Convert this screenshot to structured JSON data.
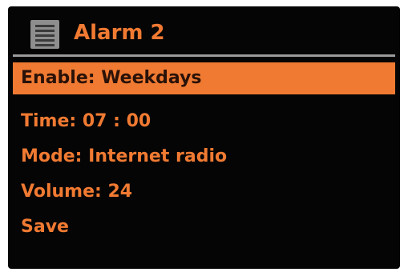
{
  "header": {
    "icon": "alarm-list-icon",
    "title": "Alarm 2"
  },
  "menu": {
    "items": [
      {
        "label": "Enable: Weekdays",
        "selected": true
      },
      {
        "label": "Time: 07 : 00",
        "selected": false
      },
      {
        "label": "Mode: Internet radio",
        "selected": false
      },
      {
        "label": "Volume: 24",
        "selected": false
      },
      {
        "label": "Save",
        "selected": false
      }
    ]
  },
  "colors": {
    "accent": "#f07a32",
    "background": "#050505",
    "selected_text": "#2a1208"
  }
}
